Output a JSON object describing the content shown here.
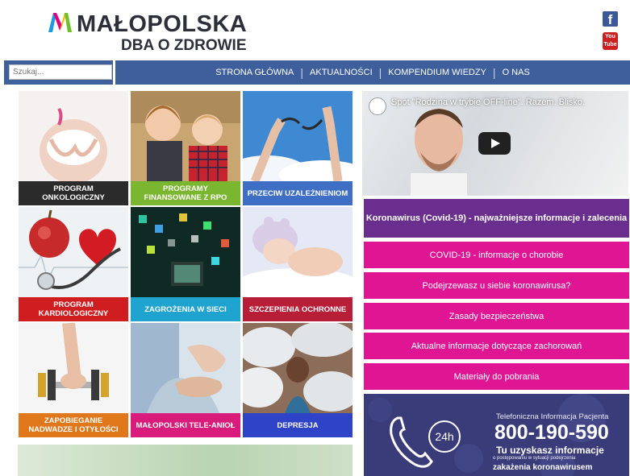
{
  "header": {
    "brand": "MAŁOPOLSKA",
    "brand_sub": "DBA O ZDROWIE",
    "social": [
      {
        "icon": "facebook-icon",
        "glyph": "f"
      },
      {
        "icon": "youtube-icon",
        "glyph": "You Tube"
      }
    ]
  },
  "search": {
    "placeholder": "Szukaj..."
  },
  "nav": {
    "items": [
      "STRONA GŁÓWNA",
      "AKTUALNOŚCI",
      "KOMPENDIUM WIEDZY",
      "O NAS"
    ]
  },
  "tiles": [
    {
      "label": "PROGRAM ONKOLOGICZNY",
      "color": "#2b2b2b",
      "icon": "breast-cancer-photo"
    },
    {
      "label": "PROGRAMY FINANSOWANE Z RPO",
      "color": "#7ab62f",
      "icon": "children-photo"
    },
    {
      "label": "PRZECIW UZALEŻNIENIOM",
      "color": "#3f6fc4",
      "icon": "broken-chain-photo"
    },
    {
      "label": "PROGRAM KARDIOLOGICZNY",
      "color": "#d01e20",
      "icon": "heart-stethoscope-photo"
    },
    {
      "label": "ZAGROŻENIA W SIECI",
      "color": "#1fa3cf",
      "icon": "internet-photo"
    },
    {
      "label": "SZCZEPIENIA OCHRONNE",
      "color": "#b91e38",
      "icon": "sleeping-baby-photo"
    },
    {
      "label": "ZAPOBIEGANIE NADWADZE I OTYŁOŚCI",
      "color": "#e0771a",
      "icon": "dumbbell-photo"
    },
    {
      "label": "MAŁOPOLSKI TELE-ANIOŁ",
      "color": "#d91b7c",
      "icon": "holding-hands-photo"
    },
    {
      "label": "DEPRESJA",
      "color": "#2f43c8",
      "icon": "depression-photo"
    }
  ],
  "video": {
    "title": "Spot \"Rodzina w trybie OFF-line\". Razem. Blisko."
  },
  "covid": {
    "main": "Koronawirus (Covid-19) - najważniejsze informacje i zalecenia",
    "buttons": [
      "COVID-19 - informacje o chorobie",
      "Podejrzewasz u siebie koronawirusa?",
      "Zasady bezpieczeństwa",
      "Aktualne informacje dotyczące zachorowań",
      "Materiały do pobrania"
    ]
  },
  "phone": {
    "hours": "24h",
    "line1": "Telefoniczna Informacja Pacjenta",
    "number": "800-190-590",
    "line2": "Tu uzyskasz informacje",
    "line3": "o postępowaniu w sytuacji podejrzenia",
    "line4": "zakażenia koronawirusem"
  }
}
